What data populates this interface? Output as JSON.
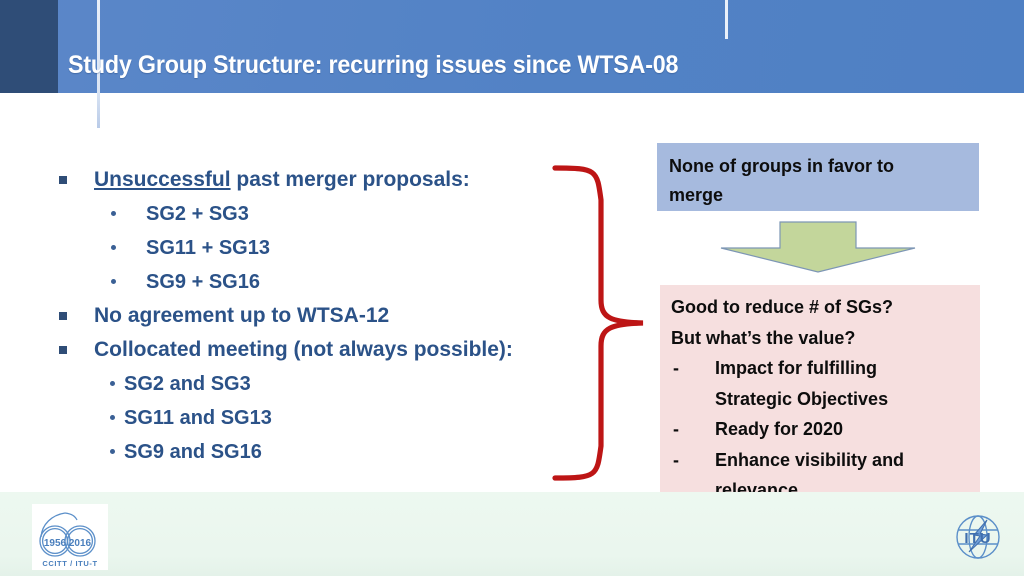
{
  "slide": {
    "title": "Study Group Structure: recurring issues since WTSA-08",
    "colors": {
      "header_blue": "#5282c5",
      "header_dark": "#2f4d77",
      "bullet_text": "#2b5288",
      "brace_red": "#bd1515",
      "callout_blue": "#a6bade",
      "callout_pink": "#f6dfdf",
      "arrow_green": "#c3d69b",
      "footer_green": "#eaf6ee"
    }
  },
  "bullets": [
    {
      "level": 1,
      "underlined_lead": "Unsuccessful",
      "rest": " past merger proposals:"
    },
    {
      "level": 2,
      "text": "SG2 + SG3"
    },
    {
      "level": 2,
      "text": "SG11 + SG13"
    },
    {
      "level": 2,
      "text": "SG9 + SG16"
    },
    {
      "level": 1,
      "text": "No agreement up to WTSA-12"
    },
    {
      "level": 1,
      "text": "Collocated meeting (not always possible):"
    },
    {
      "level": 3,
      "text": "SG2 and SG3"
    },
    {
      "level": 3,
      "text": "SG11 and SG13"
    },
    {
      "level": 3,
      "text": "SG9 and SG16"
    }
  ],
  "bullet_lines": {
    "l1_a_lead": "Unsuccessful",
    "l1_a_rest": " past merger proposals:",
    "l2_a": "SG2 + SG3",
    "l2_b": "SG11 + SG13",
    "l2_c": "SG9 + SG16",
    "l1_b": "No agreement up to WTSA-12",
    "l1_c": "Collocated meeting (not always possible):",
    "l3_a": "SG2 and SG3",
    "l3_b": "SG11 and SG13",
    "l3_c": "SG9 and SG16"
  },
  "callout_blue": {
    "line1": "None of groups in favor to",
    "line2": "merge"
  },
  "arrow": {
    "direction": "down",
    "icon": "down-arrow-icon"
  },
  "callout_pink": {
    "q1": "Good to reduce # of SGs?",
    "q2": "But what’s the value?",
    "dash": "-",
    "item1_line1": "Impact for fulfilling",
    "item1_line2": "Strategic Objectives",
    "item2": "Ready for 2020",
    "item3_line1": "Enhance visibility and",
    "item3_line2": "relevance"
  },
  "footer": {
    "anniversary_logo": {
      "year_from": "1956",
      "year_to": "2016",
      "caption": "CCITT / ITU-T"
    },
    "itu_logo": {
      "label": "ITU"
    }
  }
}
